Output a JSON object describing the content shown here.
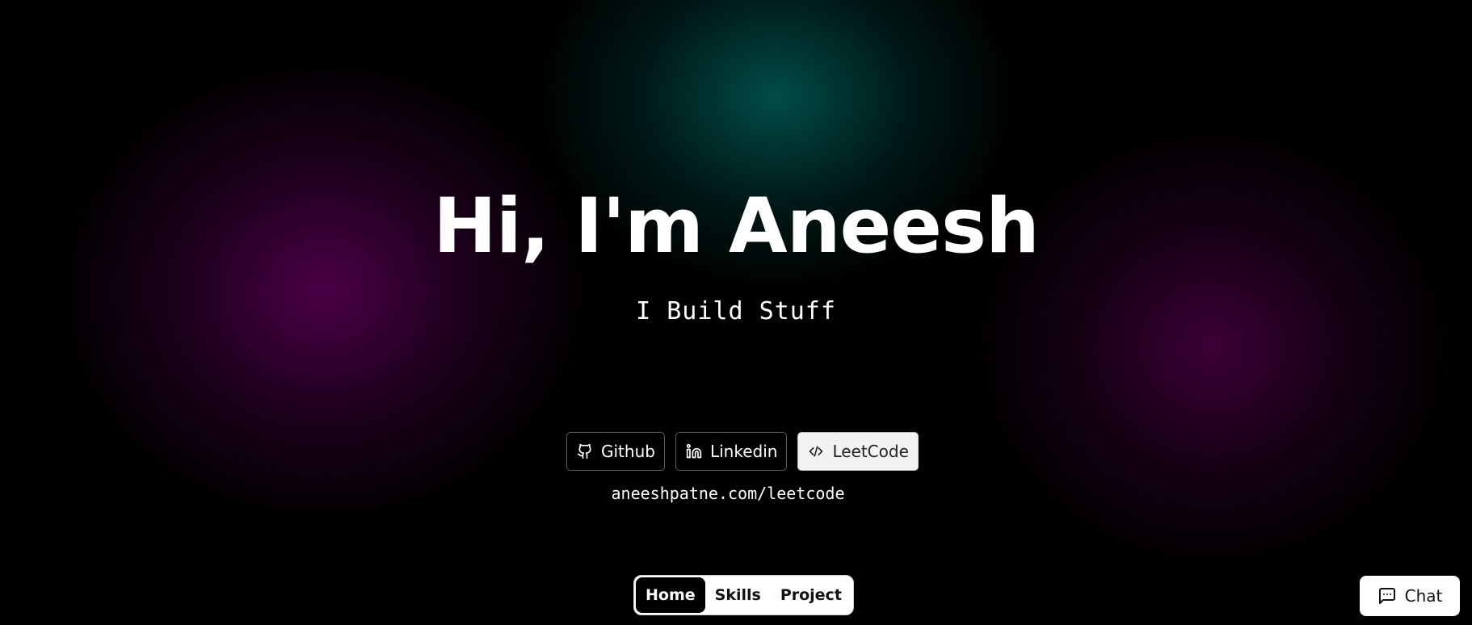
{
  "hero": {
    "title": "Hi, I'm Aneesh",
    "subtitle": "I Build Stuff"
  },
  "links": {
    "items": [
      {
        "label": "Github",
        "icon": "github-icon"
      },
      {
        "label": "Linkedin",
        "icon": "linkedin-icon"
      },
      {
        "label": "LeetCode",
        "icon": "code-icon",
        "active": true
      }
    ],
    "active_url": "aneeshpatne.com/leetcode"
  },
  "nav": {
    "items": [
      {
        "label": "Home",
        "active": true
      },
      {
        "label": "Skills"
      },
      {
        "label": "Project"
      }
    ]
  },
  "chat": {
    "label": "Chat",
    "icon": "chat-icon"
  },
  "colors": {
    "background": "#000000",
    "teal_glow": "#00504B",
    "magenta_glow": "#4E004A",
    "active_button_bg": "#F2F2F2",
    "nav_bg": "#FFFFFF"
  }
}
